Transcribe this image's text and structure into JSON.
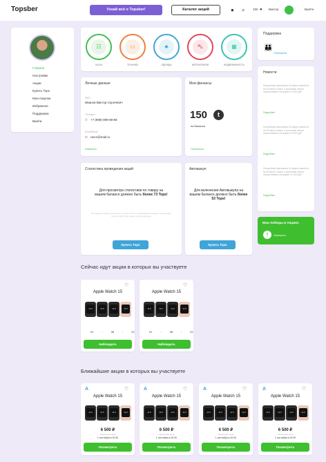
{
  "header": {
    "logo": "Topsber",
    "learn_button": "Узнай всё о Topsber!",
    "catalog_button": "Каталог акций",
    "balance": "150",
    "user_name": "Виктор",
    "logout": "Выйти"
  },
  "sidebar": {
    "items": [
      "Главная",
      "Настройки",
      "Акции",
      "Купить Tops",
      "Мои покупки",
      "Избранное",
      "Поддержка",
      "Выйти"
    ]
  },
  "categories": [
    {
      "label": "ЧАСЫ",
      "color": "#3fbf4a",
      "icon": "☷"
    },
    {
      "label": "ТЕХНИКА",
      "color": "#f07c3a",
      "icon": "▭"
    },
    {
      "label": "ОДЕЖДА",
      "color": "#3fa4d8",
      "icon": "♣"
    },
    {
      "label": "АВТОМОБИЛИ",
      "color": "#e0445a",
      "icon": "⛍"
    },
    {
      "label": "НЕДВИЖИМОСТЬ",
      "color": "#37c2b0",
      "icon": "▦"
    }
  ],
  "personal": {
    "title": "Личные данные",
    "name_label": "ФИО",
    "name": "Иванов Виктор Сергеевич",
    "phone_label": "Телефон",
    "phone": "+7 (999) 999-88-88",
    "email_label": "Email/Email",
    "email": "razor@mail.ru",
    "edit_link": "Изменить"
  },
  "finance": {
    "title": "Мои финансы",
    "amount": "150",
    "caption": "на балансе",
    "link": "Пополнить"
  },
  "support": {
    "title": "Поддержка",
    "link": "Обращения"
  },
  "news": {
    "title": "Новости",
    "items": [
      {
        "text": "Лотерейный фестиваль 30 марта начнётся на 20 минут позже, а участники смогут поучаствовать на акциях 22 400 руб.",
        "link": "Подробнее"
      },
      {
        "text": "Лотерейный фестиваль 30 марта начнётся на 20 минут позже, а участники смогут поучаствовать на акциях 22 400 руб.",
        "link": "Подробнее"
      },
      {
        "text": "Лотерейный фестиваль 30 марта начнётся на 20 минут позже, а участники смогут поучаствовать на акциях 22 400 руб.",
        "link": "Подробнее"
      }
    ]
  },
  "wins": {
    "title": "Мои победы в Акциях",
    "count": "0",
    "link": "Смотреть"
  },
  "stats": {
    "title": "Статистика проведения акций",
    "message_a": "Для просмотра статистики по товару на вашем балансе должно быть",
    "message_b": "более 73 Tops!",
    "note": "Вы можете следить статистику лучших лотов и проводимым акциям и поностному тратить свои Tops среди лучшего выбора",
    "button": "Купить Tops"
  },
  "autobuy": {
    "title": "Автовыкуп",
    "message_a": "Для включения Автовыкупа на вашем балансе должно быть",
    "message_b": "более 53 Tops!",
    "button": "Купить Tops"
  },
  "current": {
    "title": "Сейчас идут акции в которых вы участвуете",
    "products": [
      {
        "name": "Apple Watch 15",
        "timer": [
          "01",
          "38",
          "22"
        ],
        "button": "Наблюдать"
      },
      {
        "name": "Apple Watch 15",
        "timer": [
          "01",
          "38",
          "22"
        ],
        "button": "Наблюдать"
      }
    ]
  },
  "upcoming": {
    "title": "Ближайшие акции в которых вы участвуете",
    "products": [
      {
        "name": "Apple Watch 15",
        "price": "6 500 ₽",
        "sub": "Начальная цена",
        "date": "1 сентября в 20:30",
        "button": "Посмотреть"
      },
      {
        "name": "Apple Watch 15",
        "price": "6 500 ₽",
        "sub": "Начальная цена",
        "date": "1 сентября в 20:30",
        "button": "Посмотреть"
      },
      {
        "name": "Apple Watch 15",
        "price": "6 500 ₽",
        "sub": "Начальная цена",
        "date": "1 сентября в 20:30",
        "button": "Посмотреть"
      },
      {
        "name": "Apple Watch 15",
        "price": "6 500 ₽",
        "sub": "Начальная цена",
        "date": "1 сентября в 20:30",
        "button": "Посмотреть"
      }
    ]
  },
  "watch_face": "11:5"
}
